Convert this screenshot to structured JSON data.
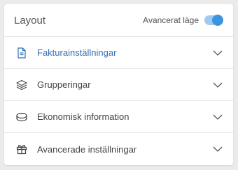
{
  "header": {
    "title": "Layout",
    "advanced_label": "Avancerat läge",
    "advanced_enabled": true
  },
  "colors": {
    "accent": "#3e93e0",
    "active_text": "#2f6fb5"
  },
  "sections": [
    {
      "label": "Fakturainställningar",
      "icon": "document-icon",
      "active": true
    },
    {
      "label": "Grupperingar",
      "icon": "layers-icon",
      "active": false
    },
    {
      "label": "Ekonomisk information",
      "icon": "coins-icon",
      "active": false
    },
    {
      "label": "Avancerade inställningar",
      "icon": "gift-box-icon",
      "active": false
    }
  ]
}
